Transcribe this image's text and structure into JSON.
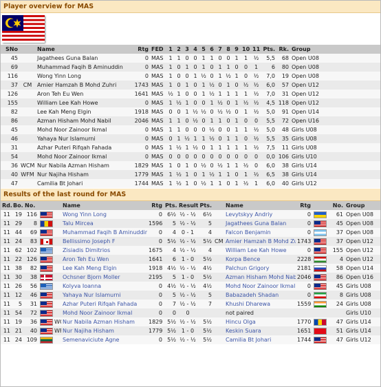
{
  "overview": {
    "title": "Player overview for MAS",
    "headers": [
      "SNo",
      "",
      "Name",
      "Rtg",
      "FED",
      "1",
      "2",
      "3",
      "4",
      "5",
      "6",
      "7",
      "8",
      "9",
      "10",
      "11",
      "Pts.",
      "Rk.",
      "Group"
    ],
    "rows": [
      [
        "45",
        "",
        "Jagathees Guna Balan",
        "0",
        "MAS",
        "1",
        "1",
        "0",
        "0",
        "1",
        "1",
        "0",
        "0",
        "1",
        "1",
        "½",
        "5,5",
        "68",
        "Open U08"
      ],
      [
        "69",
        "",
        "Muhammad Faqih B Aminuddin",
        "0",
        "MAS",
        "1",
        "0",
        "1",
        "0",
        "1",
        "0",
        "1",
        "1",
        "0",
        "0",
        "1",
        "6",
        "80",
        "Open U08"
      ],
      [
        "116",
        "",
        "Wong Yinn Long",
        "0",
        "MAS",
        "1",
        "0",
        "0",
        "1",
        "½",
        "0",
        "1",
        "½",
        "1",
        "0",
        "½",
        "7,0",
        "19",
        "Open U08"
      ],
      [
        "37",
        "CM",
        "Amier Hamzah B Mohd Zuhri",
        "1743",
        "MAS",
        "1",
        "0",
        "1",
        "0",
        "1",
        "½",
        "0",
        "1",
        "0",
        "½",
        "½",
        "6,0",
        "57",
        "Open U12"
      ],
      [
        "126",
        "",
        "Aron Teh Eu Wen",
        "1641",
        "MAS",
        "½",
        "1",
        "0",
        "0",
        "1",
        "½",
        "1",
        "1",
        "1",
        "1",
        "½",
        "7,0",
        "31",
        "Open U12"
      ],
      [
        "155",
        "",
        "William Lee Kah Howe",
        "0",
        "MAS",
        "1",
        "½",
        "1",
        "0",
        "0",
        "1",
        "½",
        "0",
        "1",
        "½",
        "½",
        "4,5",
        "118",
        "Open U12"
      ],
      [
        "82",
        "",
        "Lee Kah Meng Elgin",
        "1918",
        "MAS",
        "0",
        "0",
        "1",
        "½",
        "½",
        "0",
        "½",
        "½",
        "0",
        "1",
        "½",
        "5,0",
        "91",
        "Open U14"
      ],
      [
        "86",
        "",
        "Azman Hisham Mohd Nabil",
        "2046",
        "MAS",
        "1",
        "1",
        "0",
        "½",
        "0",
        "1",
        "1",
        "0",
        "1",
        "0",
        "0",
        "5,5",
        "72",
        "Open U16"
      ],
      [
        "45",
        "",
        "Mohd Noor Zainoor Ikmal",
        "0",
        "MAS",
        "1",
        "1",
        "0",
        "0",
        "0",
        "½",
        "0",
        "0",
        "1",
        "1",
        "½",
        "5,0",
        "48",
        "Girls U08"
      ],
      [
        "46",
        "",
        "Yahaya Nur Islamurni",
        "0",
        "MAS",
        "0",
        "1",
        "½",
        "1",
        "1",
        "½",
        "0",
        "1",
        "1",
        "0",
        "½",
        "5,5",
        "35",
        "Girls U08"
      ],
      [
        "31",
        "",
        "Azhar Puteri Rifqah Fahada",
        "0",
        "MAS",
        "1",
        "½",
        "1",
        "½",
        "0",
        "1",
        "1",
        "1",
        "1",
        "1",
        "½",
        "7,5",
        "11",
        "Girls U08"
      ],
      [
        "54",
        "",
        "Mohd Noor Zainoor Ikmal",
        "0",
        "MAS",
        "0",
        "0",
        "0",
        "0",
        "0",
        "0",
        "0",
        "0",
        "0",
        "0",
        "0",
        "0,0",
        "106",
        "Girls U10"
      ],
      [
        "36",
        "WCM",
        "Nur Nabila Azman Hisham",
        "1829",
        "MAS",
        "1",
        "0",
        "1",
        "0",
        "½",
        "0",
        "½",
        "1",
        "1",
        "½",
        "0",
        "6,0",
        "38",
        "Girls U14"
      ],
      [
        "40",
        "WFM",
        "Nur Najiha Hisham",
        "1779",
        "MAS",
        "1",
        "½",
        "1",
        "0",
        "1",
        "½",
        "1",
        "1",
        "0",
        "1",
        "½",
        "6,5",
        "38",
        "Girls U14"
      ],
      [
        "47",
        "",
        "Camilia Bt Johari",
        "1744",
        "MAS",
        "1",
        "½",
        "1",
        "0",
        "½",
        "1",
        "1",
        "0",
        "1",
        "½",
        "1",
        "6,0",
        "40",
        "Girls U12"
      ]
    ]
  },
  "results": {
    "title": "Results of the last round for MAS",
    "headers": [
      "Rd.",
      "Bo.",
      "No.",
      "",
      "Name",
      "Rtg",
      "Pts.",
      "Result",
      "Pts.",
      "",
      "Name",
      "Rtg",
      "",
      "No.",
      "Group"
    ],
    "rows": [
      {
        "rd": "11",
        "bo": "19",
        "no": "116",
        "f1": "mas",
        "t1": "",
        "n1": "Wong Yinn Long",
        "r1": "0",
        "p1": "6½",
        "res": "½ - ½",
        "p2": "6½",
        "t2": "",
        "n2": "Levytskyy Andriy",
        "r2": "0",
        "f2": "ukr",
        "no2": "61",
        "grp": "Open U08"
      },
      {
        "rd": "11",
        "bo": "29",
        "no": "8",
        "f1": "rou",
        "t1": "",
        "n1": "Talu Mircea",
        "r1": "1596",
        "p1": "5",
        "res": "½ - ½",
        "p2": "5",
        "t2": "",
        "n2": "Jagathees Guna Balan",
        "r2": "0",
        "f2": "mas",
        "no2": "45",
        "grp": "Open U08"
      },
      {
        "rd": "11",
        "bo": "44",
        "no": "69",
        "f1": "mas",
        "t1": "",
        "n1": "Muhammad Faqih B Aminuddin",
        "r1": "0",
        "p1": "4",
        "res": "0 - 1",
        "p2": "4",
        "t2": "",
        "n2": "Falcon Benjamin",
        "r2": "0",
        "f2": "arg",
        "no2": "37",
        "grp": "Open U08"
      },
      {
        "rd": "11",
        "bo": "24",
        "no": "83",
        "f1": "can",
        "t1": "",
        "n1": "Bellissimo Joseph F",
        "r1": "0",
        "p1": "5½",
        "res": "½ - ½",
        "p2": "5½",
        "t2": "CM",
        "n2": "Amier Hamzah B Mohd Zuhri",
        "r2": "1743",
        "f2": "mas",
        "no2": "37",
        "grp": "Open U12"
      },
      {
        "rd": "11",
        "bo": "62",
        "no": "102",
        "f1": "gre",
        "t1": "",
        "n1": "Zisiadis Dimitrios",
        "r1": "1675",
        "p1": "4",
        "res": "½ - ½",
        "p2": "4",
        "t2": "",
        "n2": "William Lee Kah Howe",
        "r2": "0",
        "f2": "mas",
        "no2": "155",
        "grp": "Open U12"
      },
      {
        "rd": "11",
        "bo": "22",
        "no": "126",
        "f1": "mas",
        "t1": "",
        "n1": "Aron Teh Eu Wen",
        "r1": "1641",
        "p1": "6",
        "res": "1 - 0",
        "p2": "5½",
        "t2": "",
        "n2": "Korpa Bence",
        "r2": "2228",
        "f2": "hun",
        "no2": "4",
        "grp": "Open U12"
      },
      {
        "rd": "11",
        "bo": "38",
        "no": "82",
        "f1": "mas",
        "t1": "",
        "n1": "Lee Kah Meng Elgin",
        "r1": "1918",
        "p1": "4½",
        "res": "½ - ½",
        "p2": "4½",
        "t2": "",
        "n2": "Palchun Grigory",
        "r2": "2181",
        "f2": "rus",
        "no2": "58",
        "grp": "Open U14"
      },
      {
        "rd": "11",
        "bo": "30",
        "no": "38",
        "f1": "den",
        "t1": "",
        "n1": "Ochsner Bjorn Moller",
        "r1": "2195",
        "p1": "5",
        "res": "1 - 0",
        "p2": "5½",
        "t2": "",
        "n2": "Azman Hisham Mohd Nabil",
        "r2": "2046",
        "f2": "mas",
        "no2": "86",
        "grp": "Open U16"
      },
      {
        "rd": "11",
        "bo": "26",
        "no": "56",
        "f1": "gre",
        "t1": "",
        "n1": "Kolyva Ioanna",
        "r1": "0",
        "p1": "4½",
        "res": "½ - ½",
        "p2": "4½",
        "t2": "",
        "n2": "Mohd Noor Zainoor Ikmal",
        "r2": "0",
        "f2": "mas",
        "no2": "45",
        "grp": "Girls U08"
      },
      {
        "rd": "11",
        "bo": "12",
        "no": "46",
        "f1": "mas",
        "t1": "",
        "n1": "Yahaya Nur Islamurni",
        "r1": "0",
        "p1": "5",
        "res": "½ - ½",
        "p2": "5",
        "t2": "",
        "n2": "Babazadeh Shadan",
        "r2": "0",
        "f2": "irn",
        "no2": "8",
        "grp": "Girls U08"
      },
      {
        "rd": "11",
        "bo": "5",
        "no": "31",
        "f1": "mas",
        "t1": "",
        "n1": "Azhar Puteri Rifqah Fahada",
        "r1": "0",
        "p1": "7",
        "res": "½ - ½",
        "p2": "7",
        "t2": "",
        "n2": "Khushi Dharewa",
        "r2": "1559",
        "f2": "ind",
        "no2": "24",
        "grp": "Girls U08"
      },
      {
        "rd": "11",
        "bo": "54",
        "no": "72",
        "f1": "mas",
        "t1": "",
        "n1": "Mohd Noor Zainoor Ikmal",
        "r1": "0",
        "p1": "0",
        "res": "0",
        "p2": "",
        "t2": "",
        "n2": "not paired",
        "r2": "",
        "f2": "",
        "no2": "",
        "grp": "Girls U10"
      },
      {
        "rd": "11",
        "bo": "19",
        "no": "36",
        "f1": "mas",
        "t1": "WCM",
        "n1": "Nur Nabila Azman Hisham",
        "r1": "1829",
        "p1": "5½",
        "res": "½ - ½",
        "p2": "5½",
        "t2": "",
        "n2": "Hincu Olga",
        "r2": "1770",
        "f2": "mda",
        "no2": "47",
        "grp": "Girls U14"
      },
      {
        "rd": "11",
        "bo": "21",
        "no": "40",
        "f1": "mas",
        "t1": "WFM",
        "n1": "Nur Najiha Hisham",
        "r1": "1779",
        "p1": "5½",
        "res": "1 - 0",
        "p2": "5½",
        "t2": "",
        "n2": "Keskin Suara",
        "r2": "1651",
        "f2": "tur",
        "no2": "51",
        "grp": "Girls U14"
      },
      {
        "rd": "11",
        "bo": "24",
        "no": "109",
        "f1": "ltu",
        "t1": "",
        "n1": "Semenaviciute Agne",
        "r1": "0",
        "p1": "5½",
        "res": "½ - ½",
        "p2": "5½",
        "t2": "",
        "n2": "Camilia Bt Johari",
        "r2": "1744",
        "f2": "mas",
        "no2": "47",
        "grp": "Girls U12"
      }
    ]
  },
  "colors": {
    "header_bg": "#fbe8c2",
    "header_text": "#8a4b00",
    "link": "#3d56a8",
    "th_bg": "#c9c9c9"
  }
}
